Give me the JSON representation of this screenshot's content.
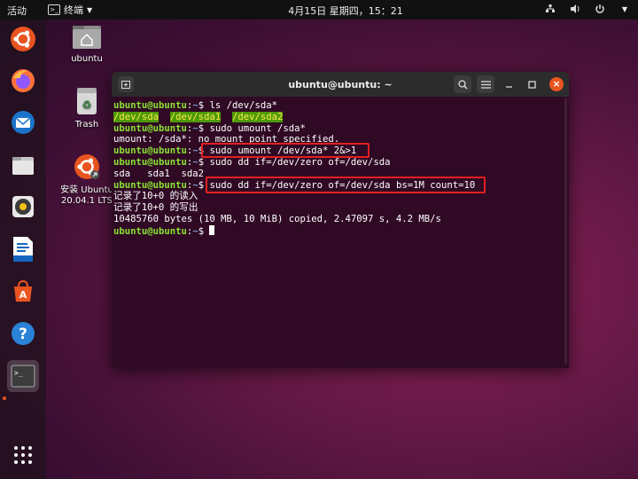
{
  "topbar": {
    "activities": "活动",
    "app_menu": "终端",
    "clock": "4月15日 星期四，15：21"
  },
  "desktop": {
    "home_label": "ubuntu",
    "trash_label": "Trash",
    "install_label_1": "安装 Ubuntu",
    "install_label_2": "20.04.1 LTS"
  },
  "terminal": {
    "title": "ubuntu@ubuntu: ~",
    "user": "ubuntu@ubuntu",
    "path": "~",
    "lines": {
      "l1_cmd": "ls /dev/sda*",
      "l2_a": "/dev/sda",
      "l2_b": "/dev/sda1",
      "l2_c": "/dev/sda2",
      "l3_cmd": "sudo umount /sda*",
      "l4_out": "umount: /sda*: no mount point specified.",
      "l5_cmd": "sudo umount /dev/sda* 2&>1",
      "l6_cmd": "sudo dd if=/dev/zero of=/dev/sda",
      "l7_out": "sda   sda1  sda2",
      "l8_cmd": "sudo dd if=/dev/zero of=/dev/sda bs=1M count=10",
      "l9_out": "记录了10+0 的读入",
      "l10_out": "记录了10+0 的写出",
      "l11_out": "10485760 bytes (10 MB, 10 MiB) copied, 2.47097 s, 4.2 MB/s"
    }
  },
  "colors": {
    "accent": "#e95420",
    "terminal_bg": "#300a24",
    "prompt_user": "#8ae234",
    "prompt_path": "#729fcf",
    "highlight_box": "#e02020"
  },
  "icons": {
    "dock": [
      "ubuntu-logo-icon",
      "firefox-icon",
      "thunderbird-icon",
      "files-icon",
      "rhythmbox-icon",
      "writer-icon",
      "software-icon",
      "help-icon",
      "terminal-icon",
      "app-grid-icon"
    ],
    "tray": [
      "network-icon",
      "volume-icon",
      "power-icon"
    ]
  }
}
